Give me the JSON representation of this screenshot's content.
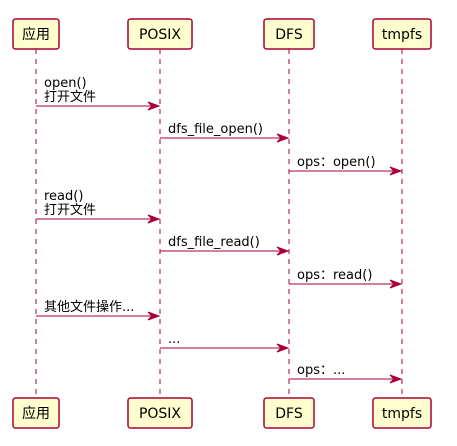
{
  "colors": {
    "participant_fill": "#fefece",
    "line": "#a80036",
    "text": "#000000"
  },
  "participants": [
    {
      "id": "app",
      "label": "应用"
    },
    {
      "id": "posix",
      "label": "POSIX"
    },
    {
      "id": "dfs",
      "label": "DFS"
    },
    {
      "id": "tmpfs",
      "label": "tmpfs"
    }
  ],
  "messages": [
    {
      "from": "app",
      "to": "posix",
      "lines": [
        "open()",
        "打开文件"
      ]
    },
    {
      "from": "posix",
      "to": "dfs",
      "lines": [
        "dfs_file_open()"
      ]
    },
    {
      "from": "dfs",
      "to": "tmpfs",
      "lines": [
        "ops：open()"
      ]
    },
    {
      "from": "app",
      "to": "posix",
      "lines": [
        "read()",
        "打开文件"
      ]
    },
    {
      "from": "posix",
      "to": "dfs",
      "lines": [
        "dfs_file_read()"
      ]
    },
    {
      "from": "dfs",
      "to": "tmpfs",
      "lines": [
        "ops：read()"
      ]
    },
    {
      "from": "app",
      "to": "posix",
      "lines": [
        "其他文件操作..."
      ]
    },
    {
      "from": "posix",
      "to": "dfs",
      "lines": [
        "..."
      ]
    },
    {
      "from": "dfs",
      "to": "tmpfs",
      "lines": [
        "ops：..."
      ]
    }
  ]
}
